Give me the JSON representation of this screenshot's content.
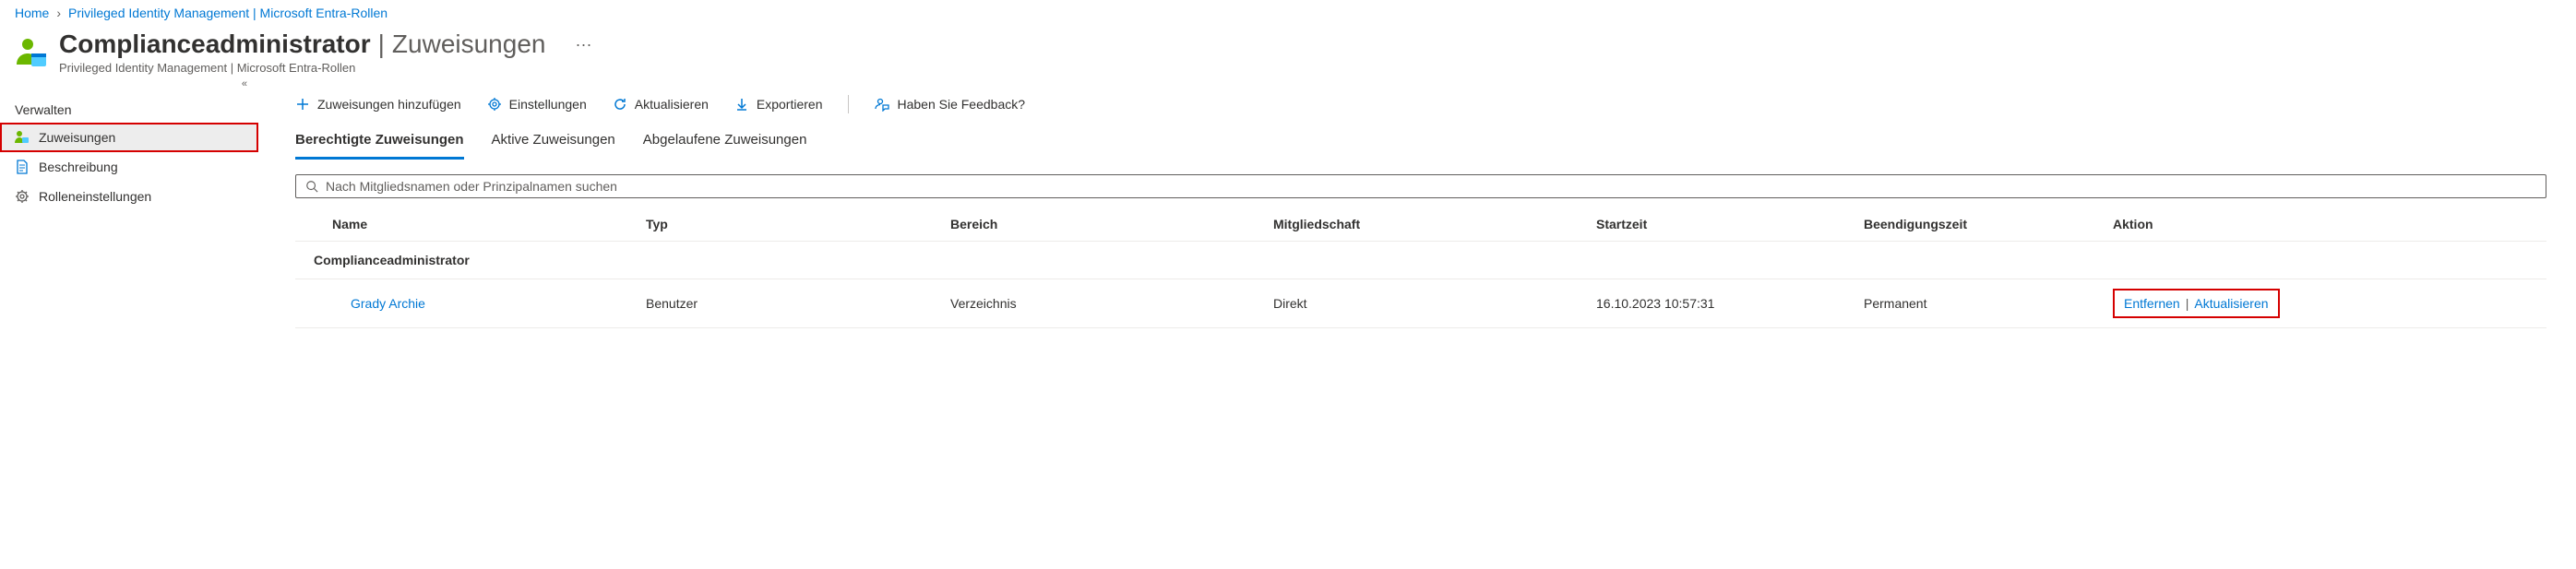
{
  "breadcrumb": {
    "home": "Home",
    "parent": "Privileged Identity Management | Microsoft Entra-Rollen"
  },
  "header": {
    "title_strong": "Complianceadministrator",
    "title_light": "Zuweisungen",
    "subtitle": "Privileged Identity Management | Microsoft Entra-Rollen",
    "more": "···"
  },
  "sidebar": {
    "collapse_glyph": "«",
    "section_label": "Verwalten",
    "items": [
      {
        "label": "Zuweisungen"
      },
      {
        "label": "Beschreibung"
      },
      {
        "label": "Rolleneinstellungen"
      }
    ]
  },
  "toolbar": {
    "add": "Zuweisungen hinzufügen",
    "settings": "Einstellungen",
    "refresh": "Aktualisieren",
    "export": "Exportieren",
    "feedback": "Haben Sie Feedback?"
  },
  "tabs": {
    "eligible": "Berechtigte Zuweisungen",
    "active": "Aktive Zuweisungen",
    "expired": "Abgelaufene Zuweisungen"
  },
  "search": {
    "placeholder": "Nach Mitgliedsnamen oder Prinzipalnamen suchen"
  },
  "table": {
    "headers": {
      "name": "Name",
      "type": "Typ",
      "scope": "Bereich",
      "membership": "Mitgliedschaft",
      "start": "Startzeit",
      "end": "Beendigungszeit",
      "action": "Aktion"
    },
    "group": "Complianceadministrator",
    "row": {
      "name": "Grady Archie",
      "type": "Benutzer",
      "scope": "Verzeichnis",
      "membership": "Direkt",
      "start": "16.10.2023 10:57:31",
      "end": "Permanent",
      "remove": "Entfernen",
      "update": "Aktualisieren",
      "sep": "|"
    }
  }
}
